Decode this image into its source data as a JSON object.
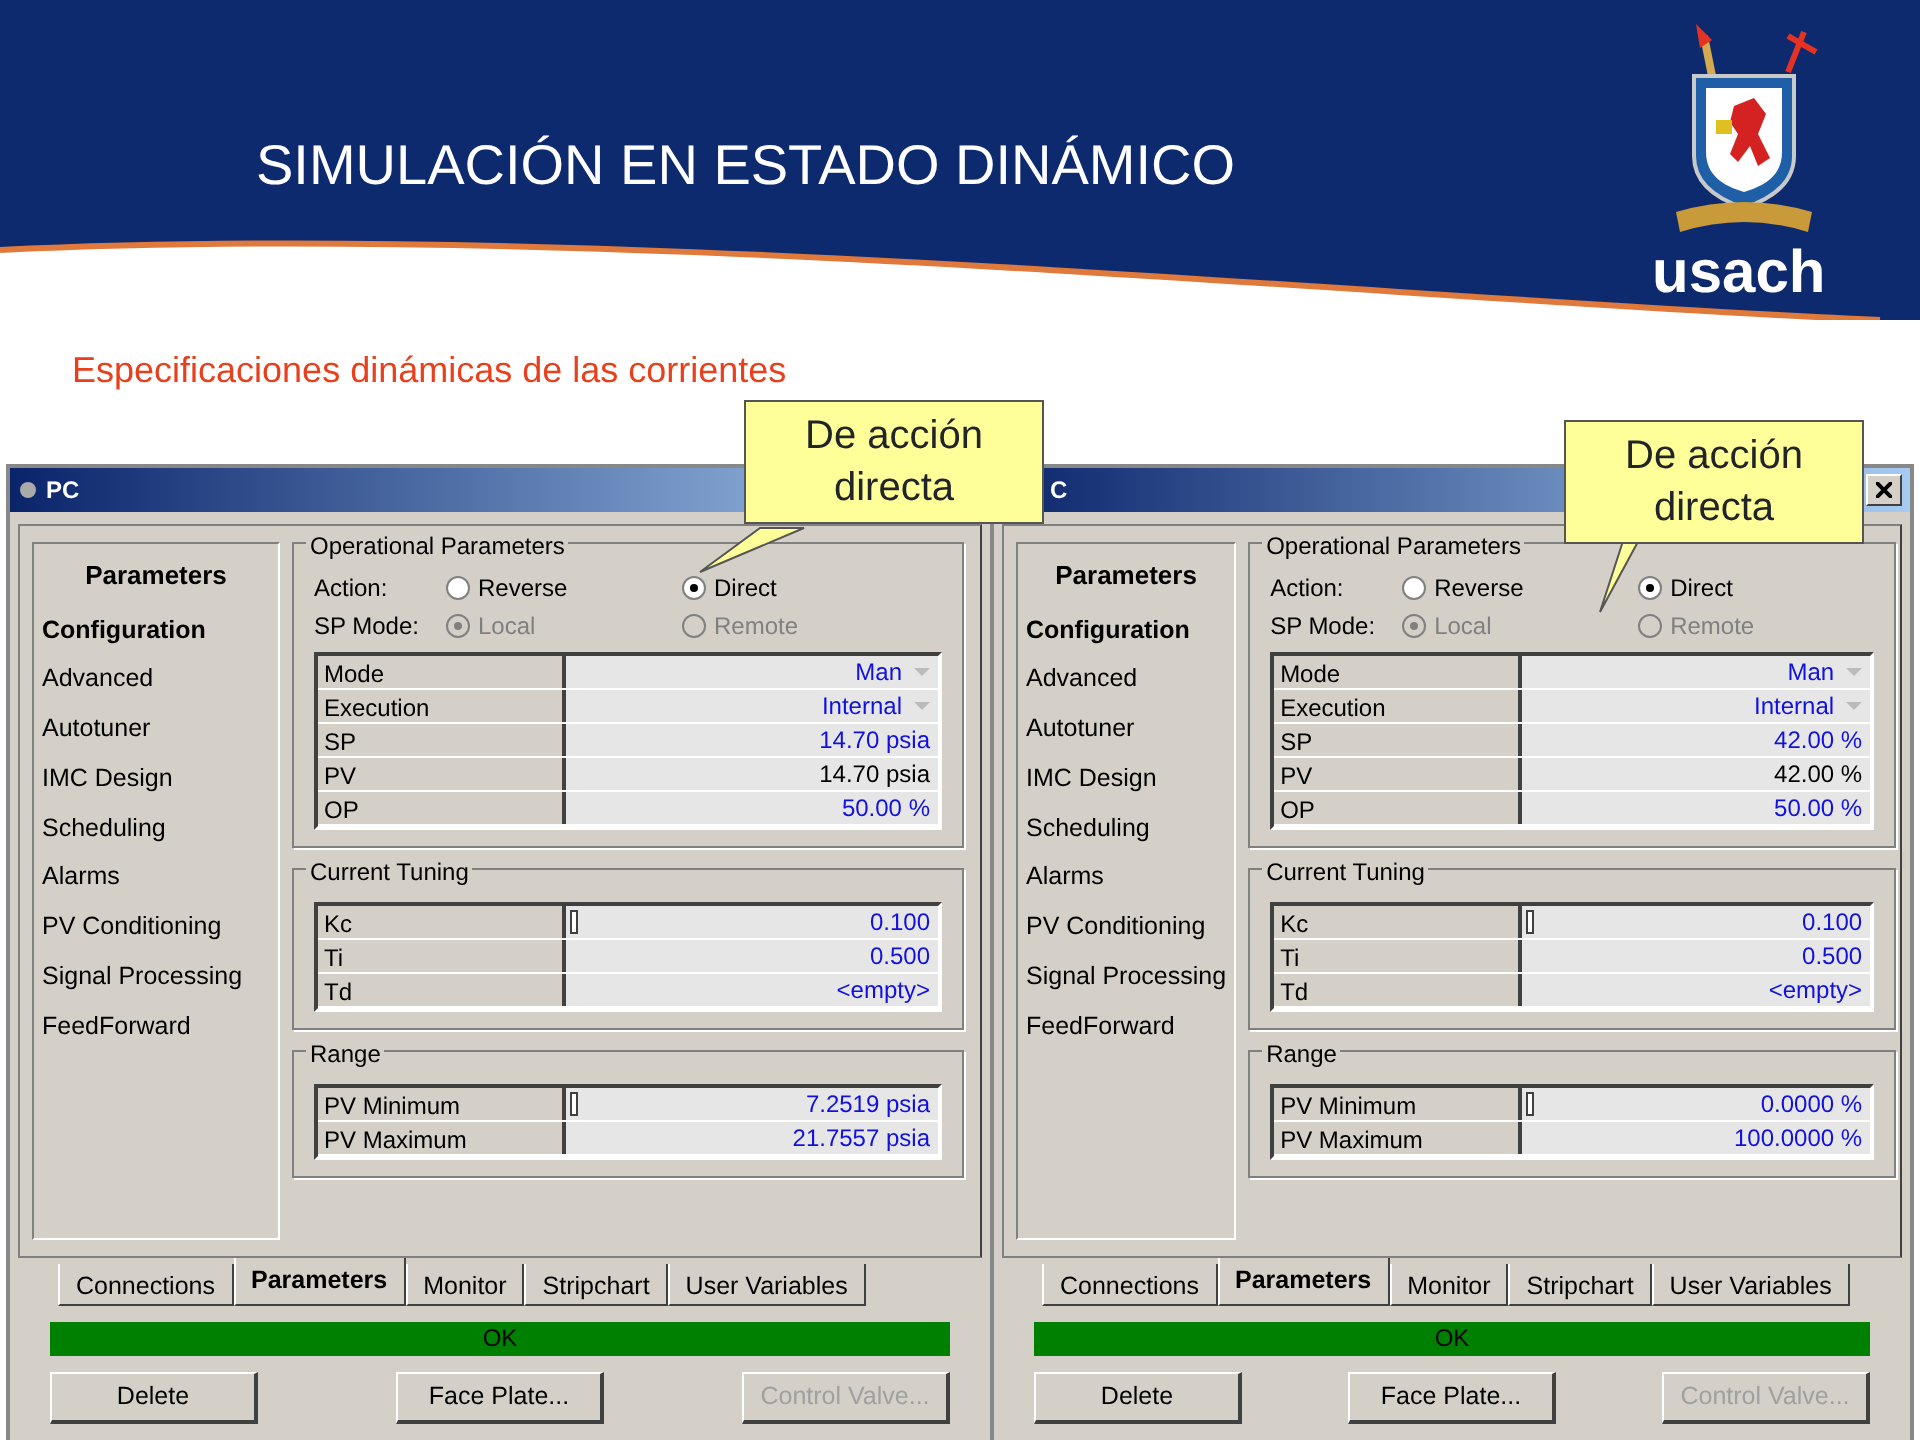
{
  "slide": {
    "title": "SIMULACIÓN EN ESTADO DINÁMICO",
    "subtitle": "Especificaciones dinámicas de las corrientes",
    "logo_text": "usach"
  },
  "windows": [
    {
      "title": "PC",
      "close_button": false,
      "sidebar": {
        "header": "Parameters",
        "items": [
          {
            "label": "Configuration",
            "selected": true
          },
          {
            "label": "Advanced",
            "selected": false
          },
          {
            "label": "Autotuner",
            "selected": false
          },
          {
            "label": "IMC Design",
            "selected": false
          },
          {
            "label": "Scheduling",
            "selected": false
          },
          {
            "label": "Alarms",
            "selected": false
          },
          {
            "label": "PV Conditioning",
            "selected": false
          },
          {
            "label": "Signal Processing",
            "selected": false
          },
          {
            "label": "FeedForward",
            "selected": false
          }
        ]
      },
      "groups": [
        {
          "kind": "operational",
          "title": "Operational Parameters",
          "radio_rows": [
            {
              "label": "Action:",
              "disabled": false,
              "options": [
                {
                  "label": "Reverse",
                  "selected": false
                },
                {
                  "label": "Direct",
                  "selected": true
                }
              ]
            },
            {
              "label": "SP Mode:",
              "disabled": true,
              "options": [
                {
                  "label": "Local",
                  "selected": true
                },
                {
                  "label": "Remote",
                  "selected": false
                }
              ]
            }
          ],
          "rows": [
            {
              "name": "Mode",
              "value": "Man",
              "kind": "dropdown",
              "handle": false
            },
            {
              "name": "Execution",
              "value": "Internal",
              "kind": "dropdown",
              "handle": false
            },
            {
              "name": "SP",
              "value": "14.70 psia",
              "kind": "input",
              "handle": false
            },
            {
              "name": "PV",
              "value": "14.70 psia",
              "kind": "output",
              "handle": false
            },
            {
              "name": "OP",
              "value": "50.00 %",
              "kind": "input",
              "handle": false
            }
          ]
        },
        {
          "kind": "table",
          "title": "Current Tuning",
          "rows": [
            {
              "name": "Kc",
              "value": "0.100",
              "kind": "input",
              "handle": true
            },
            {
              "name": "Ti",
              "value": "0.500",
              "kind": "input",
              "handle": false
            },
            {
              "name": "Td",
              "value": "<empty>",
              "kind": "input",
              "handle": false
            }
          ]
        },
        {
          "kind": "table",
          "title": "Range",
          "rows": [
            {
              "name": "PV Minimum",
              "value": "7.2519 psia",
              "kind": "input",
              "handle": true
            },
            {
              "name": "PV Maximum",
              "value": "21.7557 psia",
              "kind": "input",
              "handle": false
            }
          ]
        }
      ],
      "tabs": [
        {
          "label": "Connections",
          "selected": false
        },
        {
          "label": "Parameters",
          "selected": true
        },
        {
          "label": "Monitor",
          "selected": false
        },
        {
          "label": "Stripchart",
          "selected": false
        },
        {
          "label": "User Variables",
          "selected": false
        }
      ],
      "status": "OK",
      "buttons": [
        {
          "label": "Delete",
          "disabled": false
        },
        {
          "label": "Face Plate...",
          "disabled": false
        },
        {
          "label": "Control Valve...",
          "disabled": true
        }
      ]
    },
    {
      "title": "C",
      "close_button": true,
      "sidebar": {
        "header": "Parameters",
        "items": [
          {
            "label": "Configuration",
            "selected": true
          },
          {
            "label": "Advanced",
            "selected": false
          },
          {
            "label": "Autotuner",
            "selected": false
          },
          {
            "label": "IMC Design",
            "selected": false
          },
          {
            "label": "Scheduling",
            "selected": false
          },
          {
            "label": "Alarms",
            "selected": false
          },
          {
            "label": "PV Conditioning",
            "selected": false
          },
          {
            "label": "Signal Processing",
            "selected": false
          },
          {
            "label": "FeedForward",
            "selected": false
          }
        ]
      },
      "groups": [
        {
          "kind": "operational",
          "title": "Operational Parameters",
          "radio_rows": [
            {
              "label": "Action:",
              "disabled": false,
              "options": [
                {
                  "label": "Reverse",
                  "selected": false
                },
                {
                  "label": "Direct",
                  "selected": true
                }
              ]
            },
            {
              "label": "SP Mode:",
              "disabled": true,
              "options": [
                {
                  "label": "Local",
                  "selected": true
                },
                {
                  "label": "Remote",
                  "selected": false
                }
              ]
            }
          ],
          "rows": [
            {
              "name": "Mode",
              "value": "Man",
              "kind": "dropdown",
              "handle": false
            },
            {
              "name": "Execution",
              "value": "Internal",
              "kind": "dropdown",
              "handle": false
            },
            {
              "name": "SP",
              "value": "42.00 %",
              "kind": "input",
              "handle": false
            },
            {
              "name": "PV",
              "value": "42.00 %",
              "kind": "output",
              "handle": false
            },
            {
              "name": "OP",
              "value": "50.00 %",
              "kind": "input",
              "handle": false
            }
          ]
        },
        {
          "kind": "table",
          "title": "Current Tuning",
          "rows": [
            {
              "name": "Kc",
              "value": "0.100",
              "kind": "input",
              "handle": true
            },
            {
              "name": "Ti",
              "value": "0.500",
              "kind": "input",
              "handle": false
            },
            {
              "name": "Td",
              "value": "<empty>",
              "kind": "input",
              "handle": false
            }
          ]
        },
        {
          "kind": "table",
          "title": "Range",
          "rows": [
            {
              "name": "PV Minimum",
              "value": "0.0000 %",
              "kind": "input",
              "handle": true
            },
            {
              "name": "PV Maximum",
              "value": "100.0000 %",
              "kind": "input",
              "handle": false
            }
          ]
        }
      ],
      "tabs": [
        {
          "label": "Connections",
          "selected": false
        },
        {
          "label": "Parameters",
          "selected": true
        },
        {
          "label": "Monitor",
          "selected": false
        },
        {
          "label": "Stripchart",
          "selected": false
        },
        {
          "label": "User Variables",
          "selected": false
        }
      ],
      "status": "OK",
      "buttons": [
        {
          "label": "Delete",
          "disabled": false
        },
        {
          "label": "Face Plate...",
          "disabled": false
        },
        {
          "label": "Control Valve...",
          "disabled": true
        }
      ]
    }
  ],
  "callouts": [
    {
      "text": "De acción directa"
    },
    {
      "text": "De acción directa"
    }
  ]
}
